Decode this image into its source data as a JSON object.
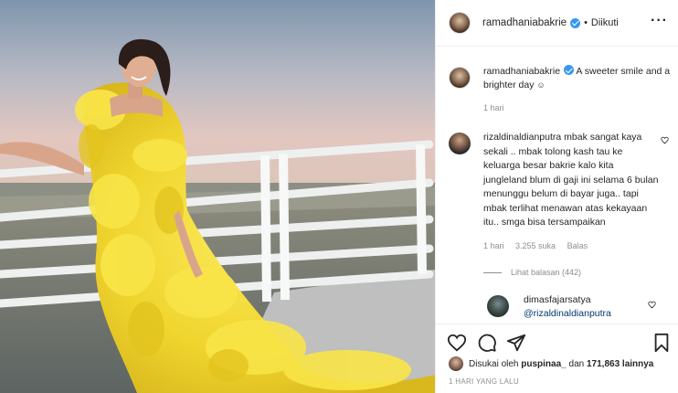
{
  "post": {
    "username": "ramadhaniabakrie",
    "follow_dot": "•",
    "follow_status": "Diikuti",
    "more_icon": "more-horizontal-icon"
  },
  "caption": {
    "username": "ramadhaniabakrie",
    "text": "A sweeter smile and a brighter day",
    "emoji": "☺",
    "time": "1 hari"
  },
  "comments": [
    {
      "username": "rizaldinaldianputra",
      "text": "mbak sangat kaya sekali .. mbak tolong kash tau ke keluarga besar bakrie kalo kita jungleland blum di gaji ini selama 6 bulan menunggu belum di bayar juga.. tapi mbak terlihat menawan atas kekayaan itu.. smga bisa tersampaikan",
      "time": "1 hari",
      "likes": "3.255 suka",
      "reply_label": "Balas",
      "view_replies": "Lihat balasan (442)"
    },
    {
      "username": "dimasfajarsatya",
      "mention": "@rizaldinaldianputra"
    }
  ],
  "actions": {
    "like_icon": "heart-icon",
    "comment_icon": "comment-icon",
    "share_icon": "share-icon",
    "save_icon": "bookmark-icon"
  },
  "likes": {
    "prefix": "Disukai oleh",
    "user": "puspinaa_",
    "middle": "dan",
    "count": "171,863 lainnya"
  },
  "time_ago": "1 HARI YANG LALU",
  "colors": {
    "verified": "#3897f0",
    "mention": "#00376b",
    "muted": "#8e8e8e",
    "dress": "#f2dc3a"
  }
}
